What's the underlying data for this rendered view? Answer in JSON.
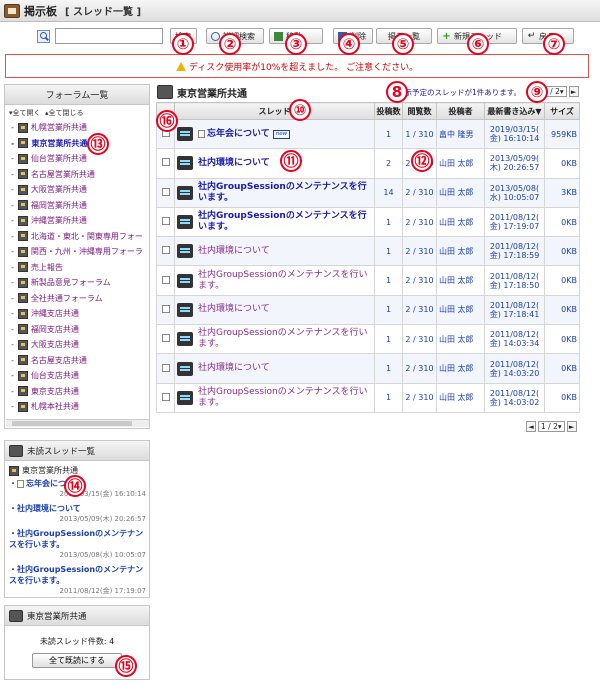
{
  "header": {
    "title": "掲示板",
    "subtitle": "[ スレッド一覧 ]"
  },
  "toolbar": {
    "search_value": "",
    "search_btn": "検索",
    "detail_search_btn": "詳細検索",
    "move_btn": "移動",
    "delete_btn": "削除",
    "forum_list_btn": "掲示一覧",
    "new_thread_btn": "新規スレッド",
    "back_btn": "戻る"
  },
  "markers": [
    "①",
    "②",
    "③",
    "④",
    "⑤",
    "⑥",
    "⑦",
    "8",
    "⑨",
    "⑩",
    "⑪",
    "⑫",
    "⑬",
    "⑭",
    "⑮",
    "⑯"
  ],
  "warning": "ディスク使用率が10%を超えました。 ご注意ください。",
  "forum_panel": {
    "title": "フォーラム一覧",
    "expand_all": "全て開く",
    "collapse_all": "全て閉じる",
    "forums": [
      "札幌営業所共通",
      "東京営業所共通",
      "仙台営業所共通",
      "名古屋営業所共通",
      "大阪営業所共通",
      "福岡営業所共通",
      "沖縄営業所共通",
      "北海道・東北・関東専用フォー",
      "関西・九州・沖縄専用フォーラ",
      "売上報告",
      "新製品意見フォーラム",
      "全社共通フォーラム",
      "沖縄支店共通",
      "福岡支店共通",
      "大阪支店共通",
      "名古屋支店共通",
      "仙台支店共通",
      "東京支店共通",
      "札幌本社共通"
    ]
  },
  "unread_panel": {
    "title": "未読スレッド一覧",
    "forum": "東京営業所共通",
    "items": [
      {
        "title": "忘年会について",
        "date": "2019/03/15(金) 16:10:14"
      },
      {
        "title": "社内環境について",
        "date": "2013/05/09(木) 20:26:57"
      },
      {
        "title": "社内GroupSessionのメンテナンスを行います。",
        "date": "2013/05/08(水) 10:05:07"
      },
      {
        "title": "社内GroupSessionのメンテナンスを行います。",
        "date": "2011/08/12(金) 17:19:07"
      }
    ]
  },
  "summary_panel": {
    "forum": "東京営業所共通",
    "unread_count": "未読スレッド件数: 4",
    "read_all_btn": "全て既読にする"
  },
  "main": {
    "forum_title": "東京営業所共通",
    "notice": "掲示予定のスレッドが1件あります。",
    "pager_value": "1 / 2",
    "pager_prev": "◄",
    "pager_next": "►",
    "columns": [
      "スレッド",
      "投稿数",
      "閲覧数",
      "投稿者",
      "最新書き込み▼",
      "サイズ"
    ],
    "rows": [
      {
        "title": "忘年会について",
        "unread": true,
        "memo": true,
        "badge": "new",
        "posts": "1",
        "views": "1 / 310",
        "author": "畠中 隆男",
        "date1": "2019/03/15(",
        "date2": "金) 16:10:14",
        "size": "959KB"
      },
      {
        "title": "社内環境について",
        "unread": true,
        "posts": "2",
        "views": "2 / 310",
        "author": "山田 太郎",
        "date1": "2013/05/09(",
        "date2": "木) 20:26:57",
        "size": "0KB"
      },
      {
        "title": "社内GroupSessionのメンテナンスを行います。",
        "unread": true,
        "posts": "14",
        "views": "2 / 310",
        "author": "山田 太郎",
        "date1": "2013/05/08(",
        "date2": "水) 10:05:07",
        "size": "3KB"
      },
      {
        "title": "社内GroupSessionのメンテナンスを行います。",
        "unread": true,
        "posts": "1",
        "views": "2 / 310",
        "author": "山田 太郎",
        "date1": "2011/08/12(",
        "date2": "金) 17:19:07",
        "size": "0KB"
      },
      {
        "title": "社内環境について",
        "unread": false,
        "posts": "1",
        "views": "2 / 310",
        "author": "山田 太郎",
        "date1": "2011/08/12(",
        "date2": "金) 17:18:59",
        "size": "0KB"
      },
      {
        "title": "社内GroupSessionのメンテナンスを行います。",
        "unread": false,
        "posts": "1",
        "views": "2 / 310",
        "author": "山田 太郎",
        "date1": "2011/08/12(",
        "date2": "金) 17:18:50",
        "size": "0KB"
      },
      {
        "title": "社内環境について",
        "unread": false,
        "posts": "1",
        "views": "2 / 310",
        "author": "山田 太郎",
        "date1": "2011/08/12(",
        "date2": "金) 17:18:41",
        "size": "0KB"
      },
      {
        "title": "社内GroupSessionのメンテナンスを行います。",
        "unread": false,
        "posts": "1",
        "views": "2 / 310",
        "author": "山田 太郎",
        "date1": "2011/08/12(",
        "date2": "金) 14:03:34",
        "size": "0KB"
      },
      {
        "title": "社内環境について",
        "unread": false,
        "posts": "1",
        "views": "2 / 310",
        "author": "山田 太郎",
        "date1": "2011/08/12(",
        "date2": "金) 14:03:20",
        "size": "0KB"
      },
      {
        "title": "社内GroupSessionのメンテナンスを行います。",
        "unread": false,
        "posts": "1",
        "views": "2 / 310",
        "author": "山田 太郎",
        "date1": "2011/08/12(",
        "date2": "金) 14:03:02",
        "size": "0KB"
      }
    ]
  },
  "colors": {
    "marker": "#e8001c",
    "link": "#1a3fb0",
    "visited": "#8a2a8a",
    "warning": "#d00000"
  }
}
